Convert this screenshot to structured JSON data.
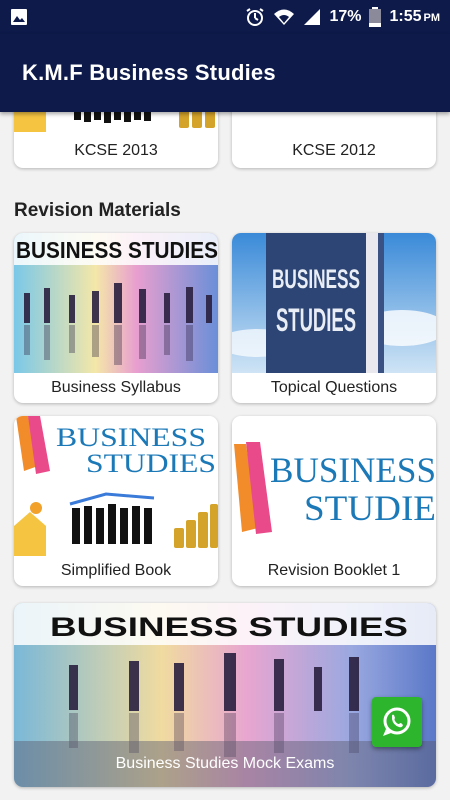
{
  "status": {
    "battery": "17%",
    "time": "1:55",
    "ampm": "PM",
    "icons": [
      "image-icon",
      "alarm-icon",
      "wifi-icon",
      "signal-icon",
      "battery-icon"
    ]
  },
  "app": {
    "title": "K.M.F Business Studies",
    "bar_color": "#0d1a4a"
  },
  "top_cards": [
    {
      "label": "KCSE 2013"
    },
    {
      "label": "KCSE 2012"
    }
  ],
  "section": {
    "title": "Revision Materials"
  },
  "cards": [
    {
      "label": "Business Syllabus",
      "image_text": "BUSINESS STUDIES"
    },
    {
      "label": "Topical Questions",
      "image_text_1": "BUSINESS",
      "image_text_2": "STUDIES"
    },
    {
      "label": "Simplified Book",
      "image_text_1": "BUSINESS",
      "image_text_2": "STUDIES"
    },
    {
      "label": "Revision Booklet 1",
      "image_text_1": "BUSINESS",
      "image_text_2": "STUDIE"
    }
  ],
  "banner": {
    "label": "Business Studies Mock Exams",
    "image_text": "BUSINESS STUDIES"
  },
  "fab": {
    "icon": "whatsapp-icon",
    "color": "#2eb52e"
  }
}
